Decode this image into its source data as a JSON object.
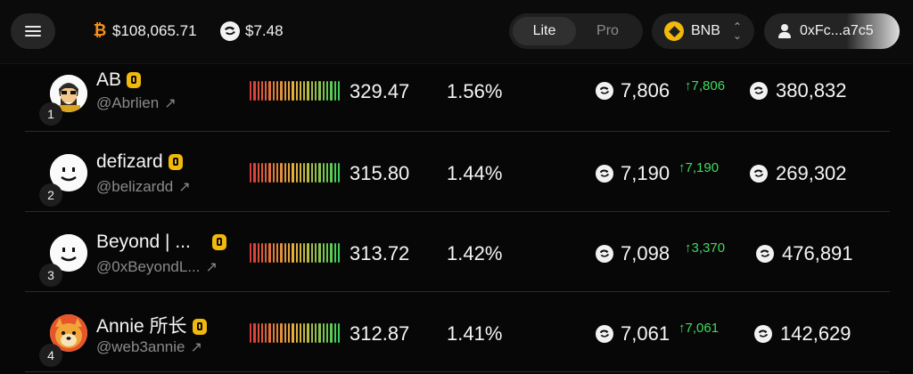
{
  "topbar": {
    "btc_price": "$108,065.71",
    "token_price": "$7.48",
    "mode_options": [
      "Lite",
      "Pro"
    ],
    "active_mode": "Lite",
    "chain": "BNB",
    "wallet_address": "0xFc...a7c5"
  },
  "colors": {
    "accent_gold": "#f0b90b",
    "positive_green": "#3ddc5e",
    "meter_gradient": [
      "#d93b3b",
      "#e5b23c",
      "#3fcf58"
    ]
  },
  "leaderboard": [
    {
      "rank": "1",
      "name": "AB",
      "handle": "@Abrlien",
      "score": "329.47",
      "percent": "1.56%",
      "points": "7,806",
      "delta": "↑7,806",
      "total": "380,832",
      "avatar_icon": "bearded-man-avatar"
    },
    {
      "rank": "2",
      "name": "defizard",
      "handle": "@belizardd",
      "score": "315.80",
      "percent": "1.44%",
      "points": "7,190",
      "delta": "↑7,190",
      "total": "269,302",
      "avatar_icon": "smiley-avatar"
    },
    {
      "rank": "3",
      "name": "Beyond | ...",
      "handle": "@0xBeyondL...",
      "score": "313.72",
      "percent": "1.42%",
      "points": "7,098",
      "delta": "↑3,370",
      "total": "476,891",
      "avatar_icon": "smiley-avatar"
    },
    {
      "rank": "4",
      "name": "Annie 所长",
      "handle": "@web3annie",
      "score": "312.87",
      "percent": "1.41%",
      "points": "7,061",
      "delta": "↑7,061",
      "total": "142,629",
      "avatar_icon": "doge-avatar"
    }
  ]
}
